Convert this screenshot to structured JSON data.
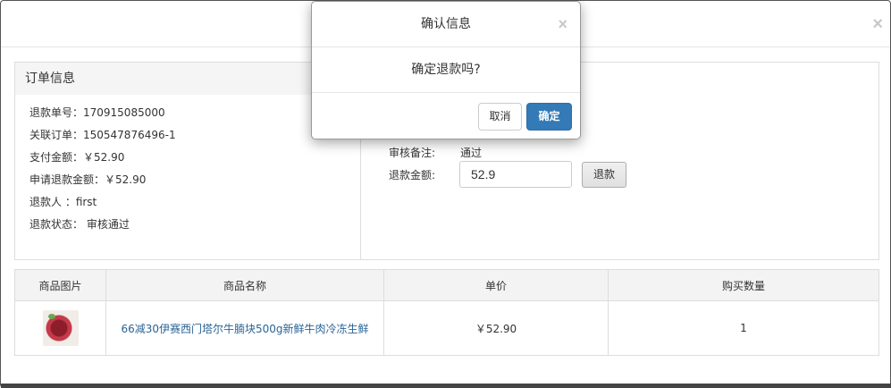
{
  "outer_modal": {
    "close_glyph": "×"
  },
  "order_info": {
    "title": "订单信息",
    "rows": [
      "退款单号：170915085000",
      "关联订单：150547876496-1",
      "支付金额：￥52.90",
      "申请退款金额：￥52.90",
      "退款人 ：first",
      "退款状态： 审核通过"
    ]
  },
  "review": {
    "note_label": "审核备注:",
    "note_value": "通过",
    "amount_label": "退款金额:",
    "amount_value": "52.9",
    "refund_button": "退款"
  },
  "products": {
    "headers": [
      "商品图片",
      "商品名称",
      "单价",
      "购买数量"
    ],
    "rows": [
      {
        "image": "product-thumbnail",
        "name": "66减30伊赛西门塔尔牛腩块500g新鲜牛肉冷冻生鲜",
        "price": "￥52.90",
        "quantity": "1"
      }
    ]
  },
  "confirm_dialog": {
    "title": "确认信息",
    "close_glyph": "×",
    "message": "确定退款吗?",
    "cancel_label": "取消",
    "ok_label": "确定"
  },
  "colors": {
    "primary": "#337ab7",
    "link": "#2a6496",
    "panel_header_bg": "#f5f5f5",
    "border": "#dddddd"
  }
}
